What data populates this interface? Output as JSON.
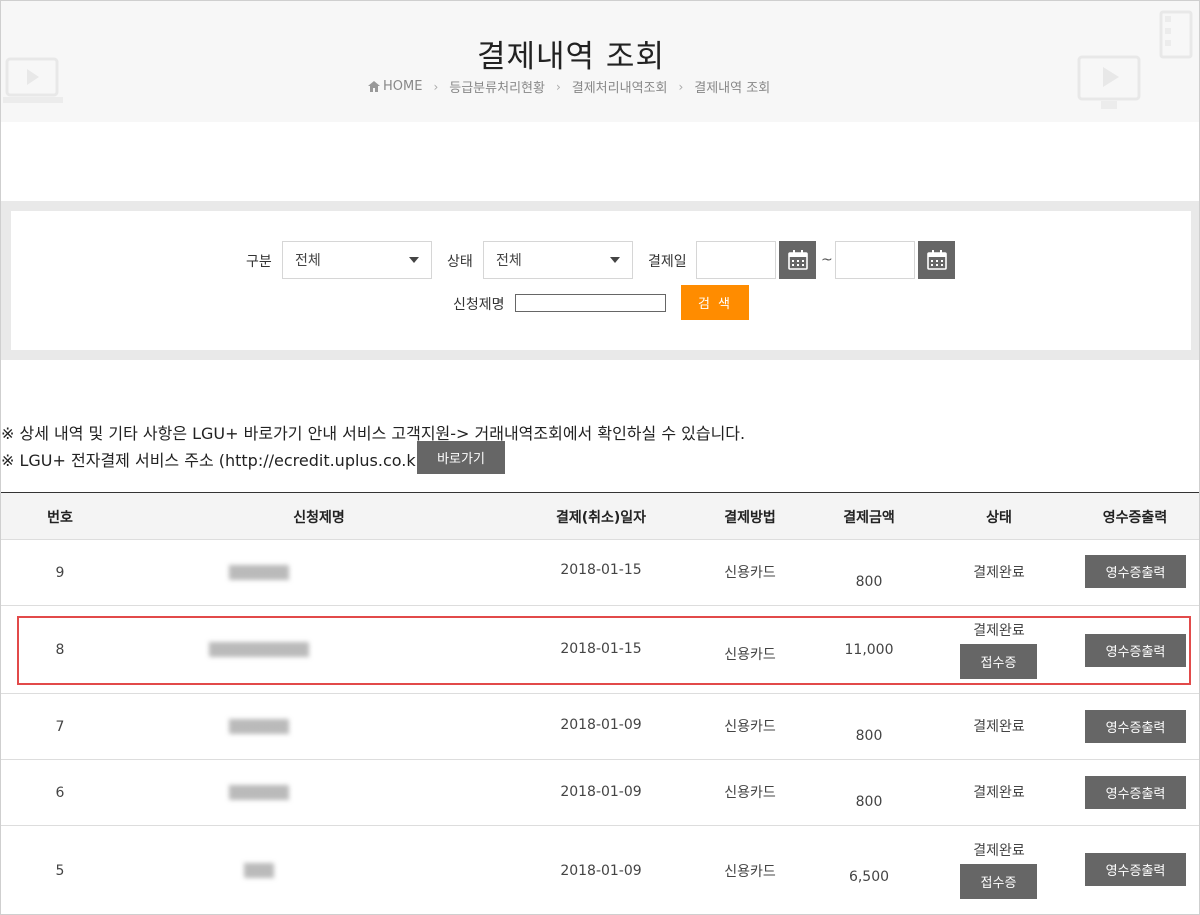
{
  "header": {
    "title": "결제내역 조회",
    "breadcrumb": [
      "HOME",
      "등급분류처리현황",
      "결제처리내역조회",
      "결제내역 조회"
    ]
  },
  "search": {
    "category_label": "구분",
    "category_value": "전체",
    "status_label": "상태",
    "status_value": "전체",
    "date_label": "결제일",
    "date_separator": "~",
    "title_label": "신청제명",
    "search_button": "검 색"
  },
  "notes": {
    "line1": "※ 상세 내역 및 기타 사항은 LGU+ 바로가기 안내 서비스 고객지원-> 거래내역조회에서 확인하실 수 있습니다.",
    "line2": "※ LGU+ 전자결제 서비스 주소 (http://ecredit.uplus.co.kr)",
    "go_button": "바로가기"
  },
  "table": {
    "headers": [
      "번호",
      "신청제명",
      "결제(취소)일자",
      "결제방법",
      "결제금액",
      "상태",
      "영수증출력"
    ],
    "receipt_button": "영수증출력",
    "accept_button": "접수증",
    "rows": [
      {
        "no": "9",
        "title": "▒▒▒▒▒▒",
        "date": "2018-01-15",
        "method": "신용카드",
        "amount": "800",
        "status": "결제완료",
        "accept": false
      },
      {
        "no": "8",
        "title": "▒▒▒▒▒▒▒▒▒▒",
        "date": "2018-01-15",
        "method": "신용카드",
        "amount": "11,000",
        "status": "결제완료",
        "accept": true
      },
      {
        "no": "7",
        "title": "▒▒▒▒▒▒",
        "date": "2018-01-09",
        "method": "신용카드",
        "amount": "800",
        "status": "결제완료",
        "accept": false
      },
      {
        "no": "6",
        "title": "▒▒▒▒▒▒",
        "date": "2018-01-09",
        "method": "신용카드",
        "amount": "800",
        "status": "결제완료",
        "accept": false
      },
      {
        "no": "5",
        "title": "▒▒▒",
        "date": "2018-01-09",
        "method": "신용카드",
        "amount": "6,500",
        "status": "결제완료",
        "accept": true
      }
    ]
  },
  "colors": {
    "accent": "#ff8c00",
    "button_gray": "#666666",
    "highlight": "#e24a4a"
  }
}
